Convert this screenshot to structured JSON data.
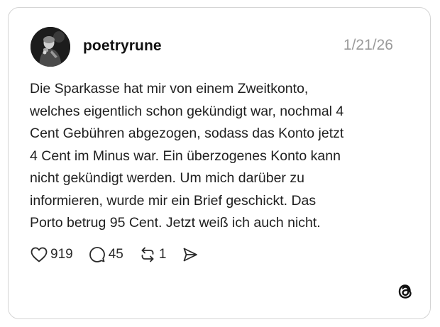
{
  "post": {
    "username": "poetryrune",
    "date": "1/21/26",
    "text": "Die Sparkasse hat mir von einem Zweitkonto,\nwelches eigentlich schon gekündigt war, nochmal 4\nCent Gebühren abgezogen, sodass das Konto jetzt\n4 Cent im Minus war. Ein überzogenes Konto kann\nnicht gekündigt werden. Um mich darüber zu\ninformieren, wurde mir ein Brief geschickt. Das\nPorto betrug 95 Cent. Jetzt weiß ich auch nicht."
  },
  "actions": {
    "like": {
      "icon": "heart-icon",
      "count": "919"
    },
    "reply": {
      "icon": "speech-bubble-icon",
      "count": "45"
    },
    "repost": {
      "icon": "repost-arrows-icon",
      "count": "1"
    },
    "share": {
      "icon": "send-arrow-icon"
    }
  },
  "branding": {
    "icon": "threads-logo-icon"
  },
  "colors": {
    "card_border": "#d4d4d4",
    "text": "#1f1f1f",
    "date": "#9a9a9a"
  }
}
